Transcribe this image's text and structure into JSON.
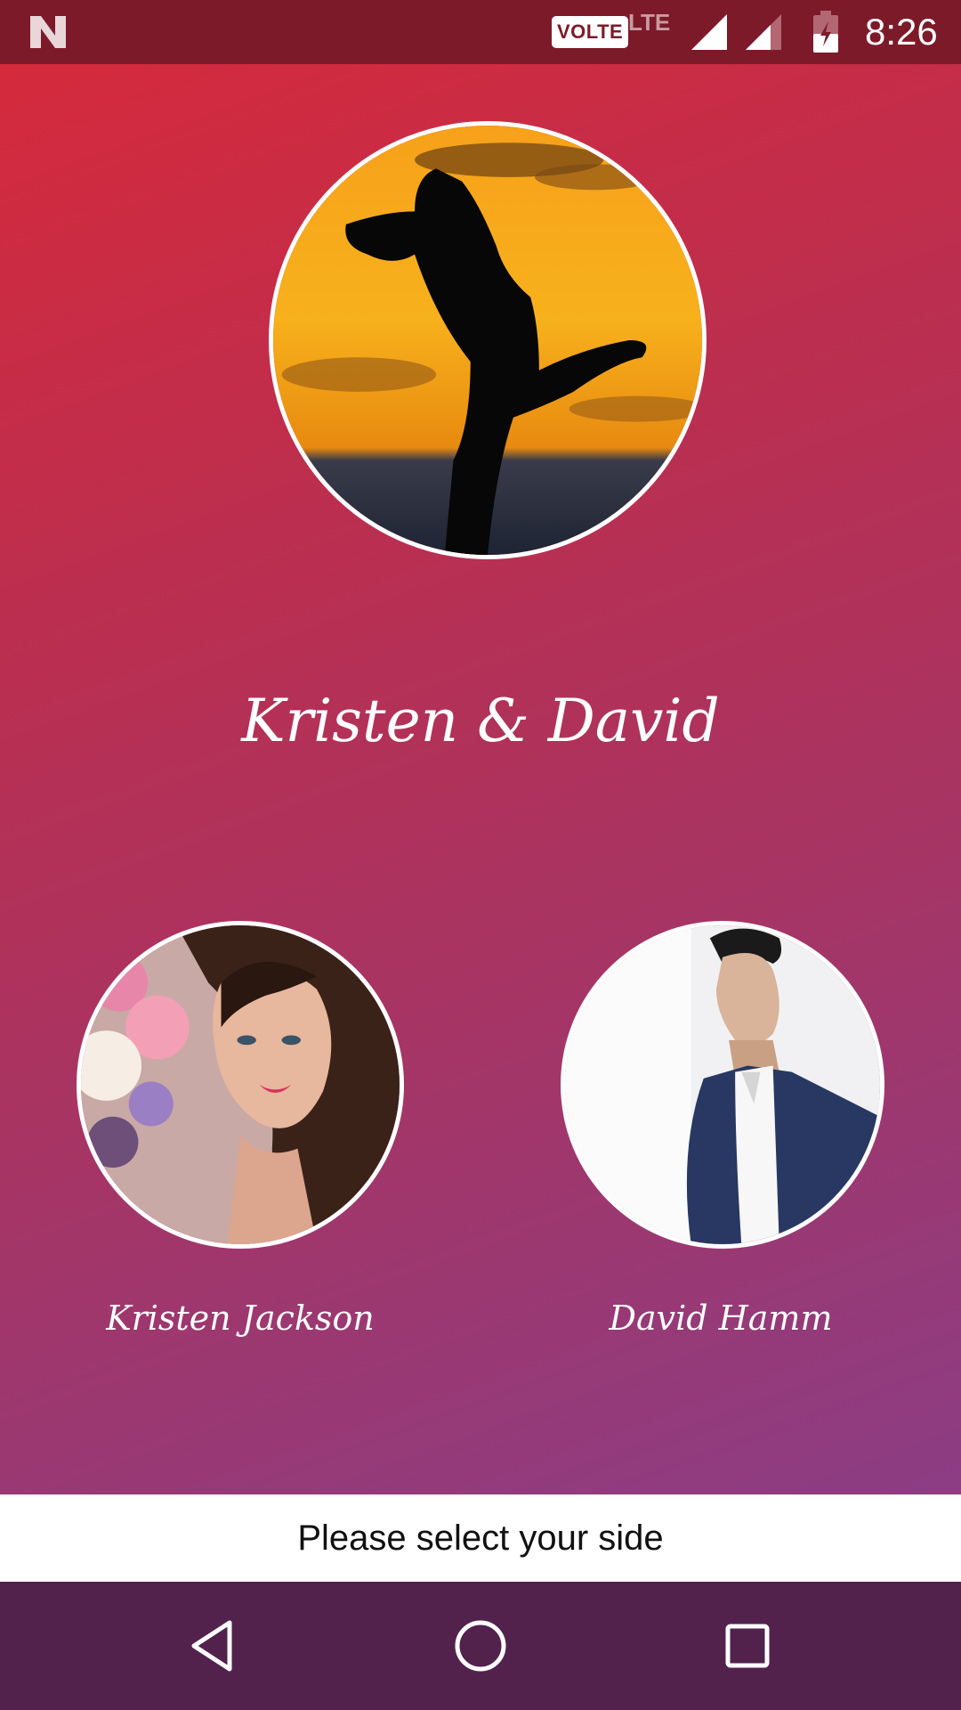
{
  "status_bar": {
    "volte_badge": "VOLTE",
    "network_type": "LTE",
    "time": "8:26",
    "icons": [
      "n-logo-icon",
      "signal-icon",
      "signal-icon",
      "battery-charging-icon"
    ]
  },
  "main": {
    "couple_title": "Kristen & David",
    "bride": {
      "name": "Kristen Jackson"
    },
    "groom": {
      "name": "David Hamm"
    }
  },
  "prompt": {
    "text": "Please select your side"
  },
  "nav_bar": {
    "icons": [
      "back-icon",
      "home-icon",
      "recents-icon"
    ]
  },
  "colors": {
    "status_bar": "#7d1a2a",
    "gradient_top": "#d52a3c",
    "gradient_bottom": "#8c3d84",
    "nav_bar": "#52224d",
    "text": "#ffffff"
  }
}
